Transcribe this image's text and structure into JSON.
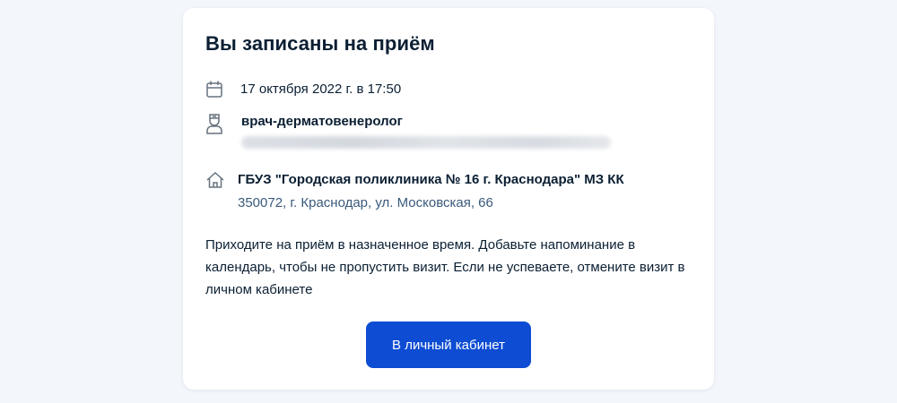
{
  "appointment": {
    "title": "Вы записаны на приём",
    "datetime": "17 октября 2022 г. в 17:50",
    "doctor": {
      "specialty": "врач-дерматовенеролог",
      "name_blurred": true
    },
    "clinic": {
      "name": "ГБУЗ \"Городская поликлиника № 16 г. Краснодара\" МЗ КК",
      "address": "350072, г. Краснодар, ул. Московская, 66"
    },
    "note": "Приходите на приём в назначенное время. Добавьте напоминание в календарь, чтобы не пропустить визит. Если не успеваете, отмените визит в личном кабинете",
    "button_label": "В личный кабинет"
  },
  "icons": {
    "date": "calendar-icon",
    "doctor": "doctor-icon",
    "clinic": "home-icon"
  },
  "colors": {
    "page_background": "#f3f6fb",
    "card_background": "#ffffff",
    "text_primary": "#0b1f33",
    "text_address": "#3a5a7a",
    "button_background": "#0d4cd3",
    "button_text": "#ffffff",
    "icon": "#66727f"
  }
}
